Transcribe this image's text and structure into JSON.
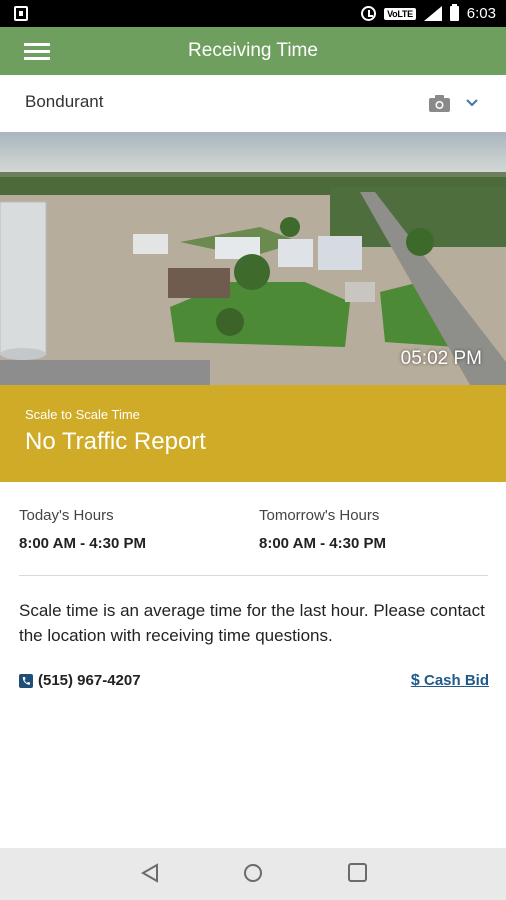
{
  "status_bar": {
    "volte": "VoLTE",
    "lte": "LTE",
    "time": "6:03"
  },
  "app_bar": {
    "title": "Receiving Time"
  },
  "location": {
    "name": "Bondurant"
  },
  "camera": {
    "timestamp": "05:02 PM"
  },
  "scale": {
    "label": "Scale to Scale Time",
    "value": "No Traffic Report",
    "color": "#cfab27"
  },
  "hours": {
    "today_label": "Today's Hours",
    "today_value": "8:00 AM -  4:30 PM",
    "tomorrow_label": "Tomorrow's Hours",
    "tomorrow_value": "8:00 AM -  4:30 PM"
  },
  "note": "Scale time is an average time for the last hour. Please contact the location with receiving time questions.",
  "contact": {
    "phone": "(515) 967-4207",
    "cash_bid_symbol": "$",
    "cash_bid_label": "Cash Bid"
  },
  "theme": {
    "app_bar_color": "#6f9f5e",
    "link_color": "#1f5a8a"
  }
}
